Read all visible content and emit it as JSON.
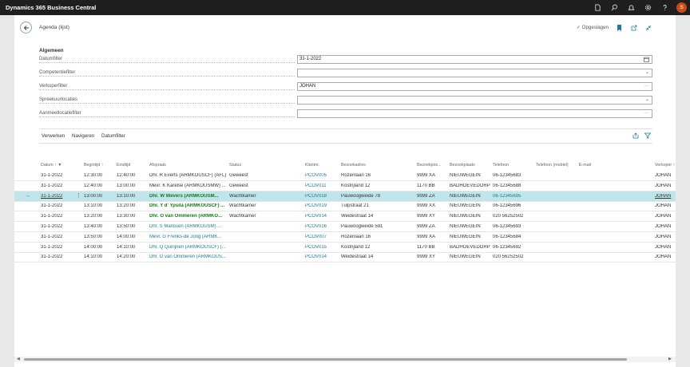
{
  "app": {
    "title": "Dynamics 365 Business Central",
    "avatar_initial": "S"
  },
  "topbar_icons": [
    "document-icon",
    "search-icon",
    "bell-icon",
    "gear-icon",
    "help-icon"
  ],
  "page": {
    "title": "Agenda (lijst)",
    "saved_label": "Opgeslagen"
  },
  "section": {
    "title": "Algemeen"
  },
  "fields": [
    {
      "label": "Datumfilter",
      "value": "31-1-2022",
      "indicator": "calendar-icon"
    },
    {
      "label": "Competentiefilter",
      "value": "",
      "indicator": "chevron-down-icon"
    },
    {
      "label": "Verkoperfilter",
      "value": "JOHAN",
      "indicator": "ellipsis"
    },
    {
      "label": "Spreekuurlocaties",
      "value": "",
      "indicator": "chevron-down-icon"
    },
    {
      "label": "Aanmeetlocatiefilter",
      "value": "",
      "indicator": "ellipsis"
    }
  ],
  "menu": {
    "items": [
      "Verwerken",
      "Navigeren",
      "Datumfilter"
    ]
  },
  "table": {
    "columns": [
      "Datum ↑ ▼",
      "Begintijd ↑",
      "Eindtijd",
      "Afspraak",
      "Status",
      "Klantnr.",
      "Bezoekadres",
      "Bezoekpos...",
      "Bezoekplaats",
      "Telefoon",
      "Telefoon (mobiel)",
      "E-mail",
      "Verkoper ↑"
    ],
    "rows": [
      [
        "31-1-2022",
        "12:30:00",
        "12:40:00",
        "Dhr. R Everts (ARMKOUSCF) (AFL)",
        "Geweest",
        "PCOV005",
        "Rozenlaan 16",
        "9999 XA",
        "NIEUWEGEIN",
        "06-12345683",
        "",
        "",
        "JOHAN"
      ],
      [
        "31-1-2022",
        "12:40:00",
        "13:00:00",
        "Mevr. K Karelse (ARMKOUSMW) ...",
        "Geweest",
        "PCOV011",
        "Kostrijland 12",
        "1170 BB",
        "BADHOEVEDORP",
        "06-12345688",
        "",
        "",
        "JOHAN"
      ],
      [
        "31-1-2022",
        "13:00:00",
        "13:10:00",
        "Dhr. W Wevers (ARMKOUSM...",
        "Wachtkamer",
        "PCOV018",
        "Pauwoogweide 78",
        "9999 ZA",
        "NIEUWEGEIN",
        "06-12345695",
        "",
        "",
        "JOHAN"
      ],
      [
        "31-1-2022",
        "13:10:00",
        "13:20:00",
        "Dhr. Y d' Ypsila (ARMKOUSCF) ...",
        "Wachtkamer",
        "PCOV019",
        "Tulpstraat 21",
        "9999 XX",
        "NIEUWEGEIN",
        "06-12345696",
        "",
        "",
        "JOHAN"
      ],
      [
        "31-1-2022",
        "13:20:00",
        "13:30:00",
        "Dhr. O van Ommeren (ARMKO...",
        "Wachtkamer",
        "PCOV014",
        "Weidestraat 14",
        "9999 XY",
        "NIEUWEGEIN",
        "020 56252502",
        "",
        "",
        "JOHAN"
      ],
      [
        "31-1-2022",
        "13:40:00",
        "13:50:00",
        "Dhr. S Marissen (ARMKOUSM) ...",
        "",
        "PCOV016",
        "Pauwoogweide 591",
        "9999 ZA",
        "NIEUWEGEIN",
        "06-12345693",
        "",
        "",
        "JOHAN"
      ],
      [
        "31-1-2022",
        "13:50:00",
        "14:00:00",
        "Mevr. G Freriks-de Jong (ARMK...",
        "",
        "PCOV007",
        "Rozenlaan 16",
        "9999 XA",
        "NIEUWEGEIN",
        "06-12345684",
        "",
        "",
        "JOHAN"
      ],
      [
        "31-1-2022",
        "14:00:00",
        "14:10:00",
        "Dhr. Q Quirijnen (ARMKOUSCF) (...",
        "",
        "PCOV015",
        "Kostrijland 12",
        "1170 BB",
        "BADHOEVEDORP",
        "06-12345692",
        "",
        "",
        "JOHAN"
      ],
      [
        "31-1-2022",
        "14:10:00",
        "14:20:00",
        "Dhr. O van Ommeren (ARMKOUS...",
        "",
        "PCOV014",
        "Weidestraat 14",
        "9999 XY",
        "NIEUWEGEIN",
        "020 56252502",
        "",
        "",
        "JOHAN"
      ]
    ],
    "selected_row": 2,
    "bold_rows": [
      2,
      3,
      4
    ]
  },
  "colors": {
    "accent": "#1a7a98",
    "selected_row": "#bfe4ea",
    "topbar": "#1f1f1f",
    "avatar": "#c84b16",
    "bold_link": "#107c10"
  }
}
